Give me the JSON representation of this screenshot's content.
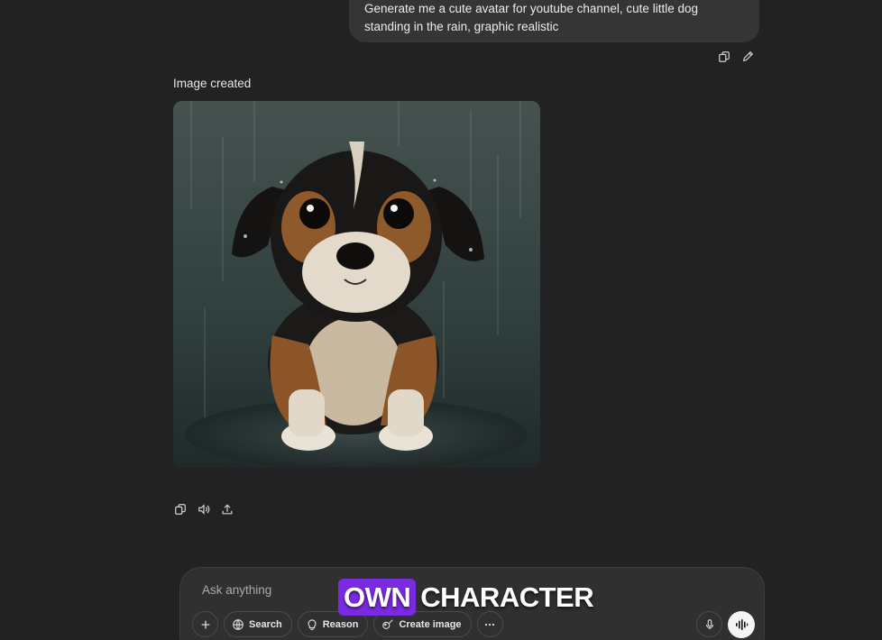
{
  "conversation": {
    "user_message": {
      "line1": "Generate me a cute avatar for youtube channel, cute little dog",
      "line2": "standing in the rain, graphic realistic"
    },
    "user_actions": {
      "copy_icon": "copy-icon",
      "edit_icon": "pencil-icon"
    },
    "assistant": {
      "label": "Image created",
      "image_subject": "puppy-in-rain",
      "actions": {
        "copy_icon": "copy-icon",
        "read_aloud_icon": "speaker-icon",
        "share_icon": "share-icon"
      }
    }
  },
  "composer": {
    "placeholder": "Ask anything",
    "tools": {
      "add_icon": "plus-icon",
      "search_label": "Search",
      "reason_label": "Reason",
      "create_image_label": "Create image",
      "more_icon": "ellipsis-icon"
    },
    "mic_icon": "microphone-icon",
    "voice_icon": "voice-mode-icon"
  },
  "caption": {
    "highlight_word": "OWN",
    "rest": "CHARACTER",
    "highlight_color": "#7a2be2"
  },
  "colors": {
    "background": "#222222",
    "bubble": "#353535",
    "composer": "#303030"
  }
}
